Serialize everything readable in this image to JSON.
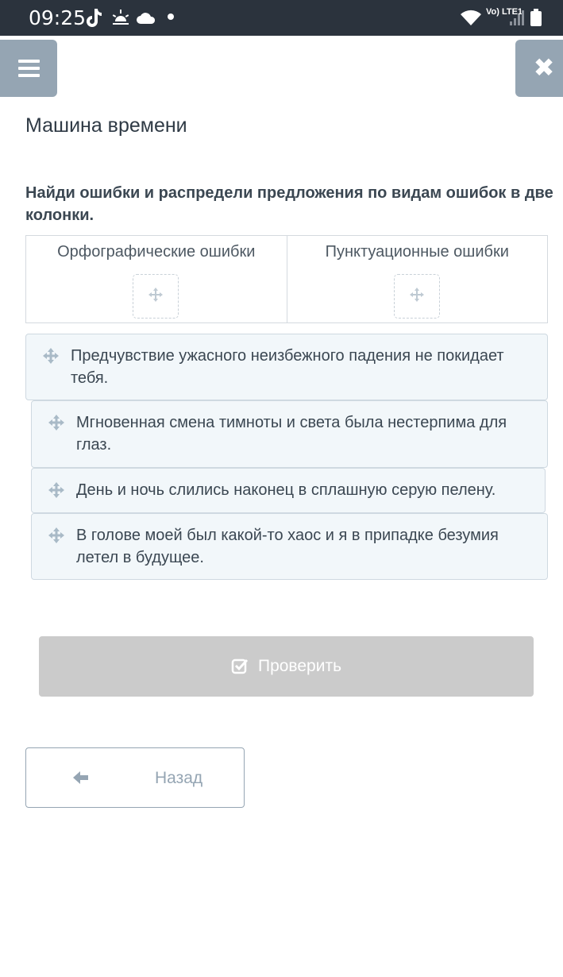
{
  "status": {
    "time": "09:25",
    "network": "Vo) LTE1",
    "icons": [
      "tiktok-icon",
      "weather-sunrise-icon",
      "cloud-icon",
      "notification-dot-icon",
      "wifi-icon",
      "signal-icon",
      "battery-icon"
    ]
  },
  "header": {
    "menu_icon": "hamburger-icon",
    "close_icon": "close-icon",
    "close_glyph": "✖"
  },
  "page": {
    "title": "Машина времени",
    "task": "Найди ошибки и распредели предложения по видам ошибок в две колонки."
  },
  "columns": [
    {
      "label": "Орфографические ошибки",
      "drop_icon": "move-target-icon"
    },
    {
      "label": "Пунктуационные ошибки",
      "drop_icon": "move-target-icon"
    }
  ],
  "items": [
    {
      "text": "Предчувствие ужасного неизбежного падения не покидает тебя.",
      "icon": "drag-handle-icon"
    },
    {
      "text": "Мгновенная смена тимноты и света была нестерпима для глаз.",
      "icon": "drag-handle-icon"
    },
    {
      "text": "День и ночь слились наконец в сплашную серую пелену.",
      "icon": "drag-handle-icon"
    },
    {
      "text": "В голове моей был какой-то хаос и я в припадке безумия летел в будущее.",
      "icon": "drag-handle-icon"
    }
  ],
  "actions": {
    "check_label": "Проверить",
    "back_label": "Назад"
  },
  "colors": {
    "status_bar": "#2b333d",
    "header_button": "#95a5b3",
    "item_bg": "#f2f7fa",
    "check_button": "#cbcbcb"
  }
}
